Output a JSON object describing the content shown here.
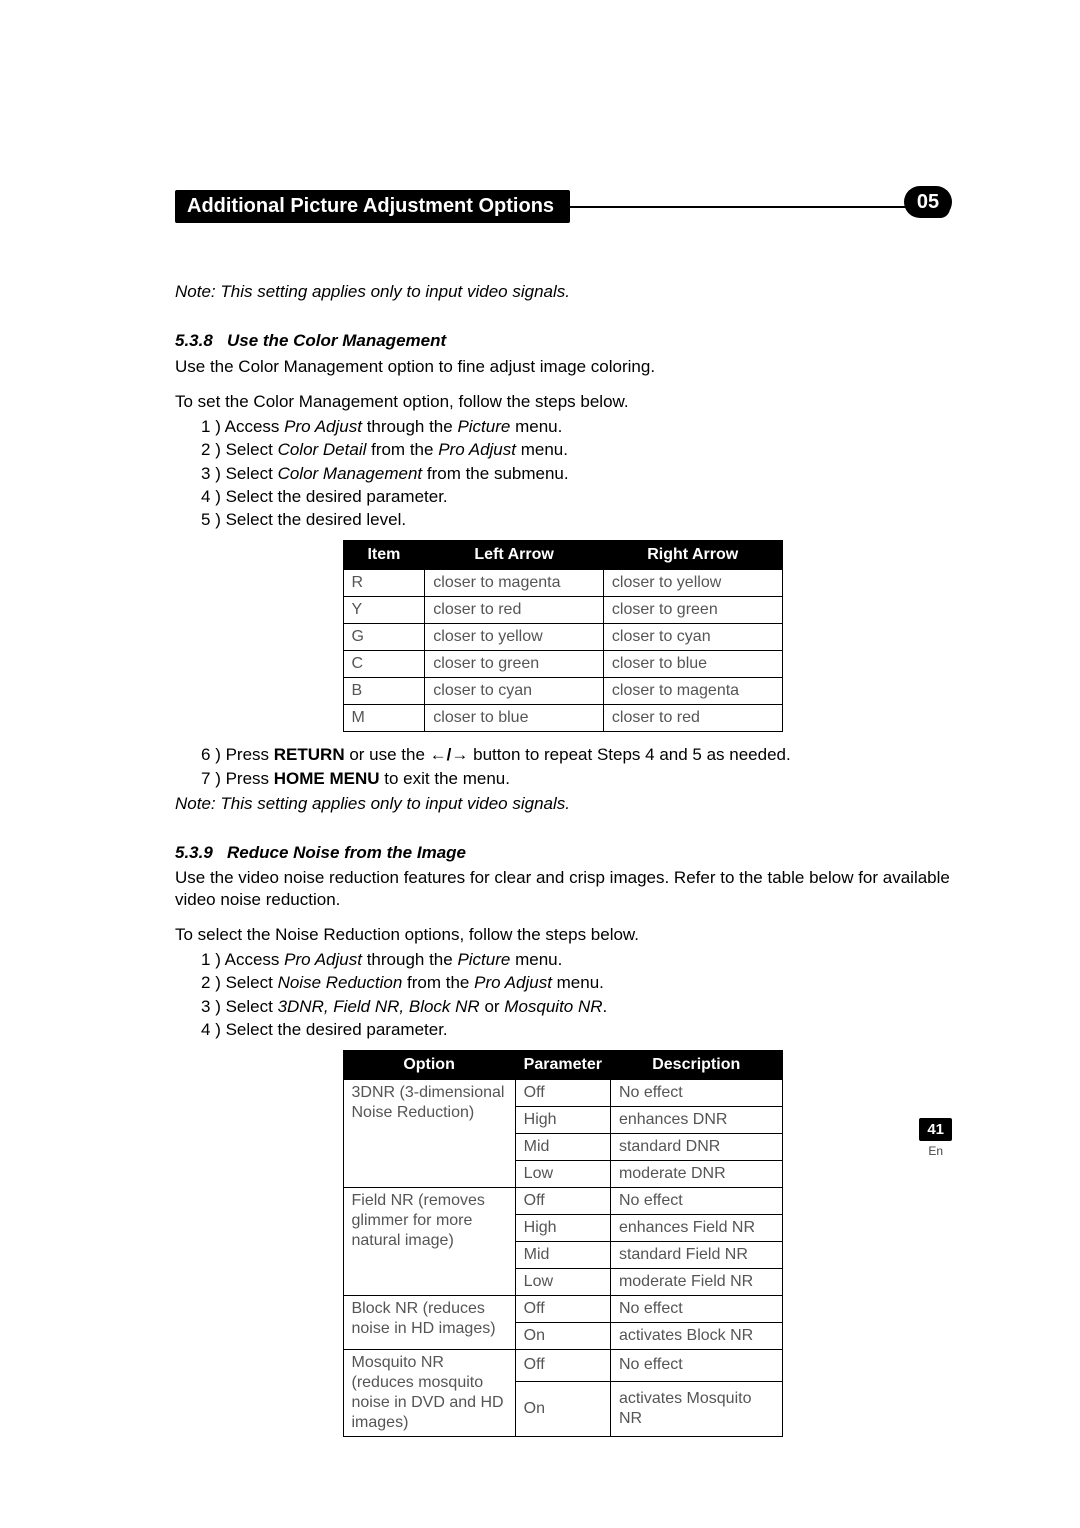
{
  "header": {
    "title": "Additional Picture Adjustment Options",
    "chapter": "05"
  },
  "note1": "Note: This setting applies only to input video signals.",
  "sec1": {
    "num": "5.3.8",
    "name": "Use the Color Management",
    "intro": "Use the Color Management option to fine adjust image coloring.",
    "lead": "To set the Color Management option, follow the steps below.",
    "s1a": "Access ",
    "s1i": "Pro Adjust",
    "s1b": " through the ",
    "s1i2": "Picture",
    "s1c": " menu.",
    "s2a": "Select ",
    "s2i": "Color Detail",
    "s2b": " from the ",
    "s2i2": "Pro Adjust",
    "s2c": " menu.",
    "s3a": "Select ",
    "s3i": "Color Management",
    "s3b": "  from the submenu.",
    "s4": "Select the desired parameter.",
    "s5": "Select the desired level."
  },
  "table_cm": {
    "head": {
      "c1": "Item",
      "c2": "Left Arrow",
      "c3": "Right Arrow"
    },
    "rows": [
      {
        "c1": "R",
        "c2": "closer to magenta",
        "c3": "closer to yellow"
      },
      {
        "c1": "Y",
        "c2": "closer to red",
        "c3": "closer to green"
      },
      {
        "c1": "G",
        "c2": "closer to yellow",
        "c3": "closer to cyan"
      },
      {
        "c1": "C",
        "c2": "closer to green",
        "c3": "closer to blue"
      },
      {
        "c1": "B",
        "c2": "closer to cyan",
        "c3": "closer to magenta"
      },
      {
        "c1": "M",
        "c2": "closer to blue",
        "c3": "closer to red"
      }
    ]
  },
  "after_cm": {
    "s6a": "Press ",
    "s6k": "RETURN",
    "s6b": " or use the ",
    "s6btn": "←/→",
    "s6c": " button to repeat Steps 4 and 5 as needed.",
    "s7a": "Press ",
    "s7k": "HOME MENU",
    "s7b": " to exit the menu."
  },
  "note2": "Note: This setting applies only to input video signals.",
  "sec2": {
    "num": "5.3.9",
    "name": "Reduce Noise from the Image",
    "intro": "Use the video noise reduction features for clear and crisp images. Refer to the table below for available video noise reduction.",
    "lead": "To select the Noise Reduction options, follow the steps below.",
    "s1a": "Access ",
    "s1i": "Pro Adjust",
    "s1b": " through the ",
    "s1i2": "Picture",
    "s1c": " menu.",
    "s2a": "Select ",
    "s2i": "Noise Reduction",
    "s2b": " from the ",
    "s2i2": "Pro Adjust",
    "s2c": " menu.",
    "s3a": "Select ",
    "s3i": "3DNR, Field NR, Block NR",
    "s3b": " or ",
    "s3i2": "Mosquito NR",
    "s3c": ".",
    "s4": "Select the desired parameter."
  },
  "table_nr": {
    "head": {
      "c1": "Option",
      "c2": "Parameter",
      "c3": "Description"
    },
    "rows": [
      {
        "opt": "3DNR (3-dimensional Noise Reduction)",
        "span": 4,
        "p": [
          "Off",
          "High",
          "Mid",
          "Low"
        ],
        "d": [
          "No effect",
          "enhances DNR",
          "standard DNR",
          "moderate DNR"
        ]
      },
      {
        "opt": "Field NR (removes glimmer for more natural image)",
        "span": 4,
        "p": [
          "Off",
          "High",
          "Mid",
          "Low"
        ],
        "d": [
          "No effect",
          "enhances Field NR",
          "standard Field NR",
          "moderate Field NR"
        ]
      },
      {
        "opt": "Block NR (reduces noise in HD images)",
        "span": 2,
        "p": [
          "Off",
          "On"
        ],
        "d": [
          "No effect",
          "activates Block NR"
        ]
      },
      {
        "opt": "Mosquito NR (reduces mosquito noise in DVD and HD images)",
        "span": 2,
        "p": [
          "Off",
          "On"
        ],
        "d": [
          "No effect",
          "activates Mosquito NR"
        ]
      }
    ]
  },
  "footer": {
    "pagenum": "41",
    "lang": "En"
  }
}
